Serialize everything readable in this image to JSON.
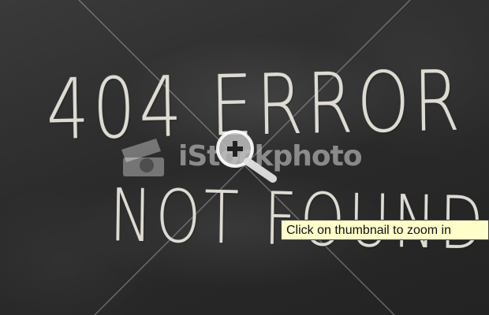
{
  "chalkboard": {
    "line1": "404 ERROR !",
    "line2": "NOT FOUND"
  },
  "watermark": {
    "brand_text": "iStockphoto",
    "logo_icon": "camera-logo-icon"
  },
  "zoom_icon": "magnifier-plus-icon",
  "tooltip": {
    "text": "Click on thumbnail to zoom in"
  },
  "colors": {
    "chalkboard": "#2b2b2b",
    "chalk": "#dedbd2",
    "tooltip_bg": "#fefecb"
  }
}
